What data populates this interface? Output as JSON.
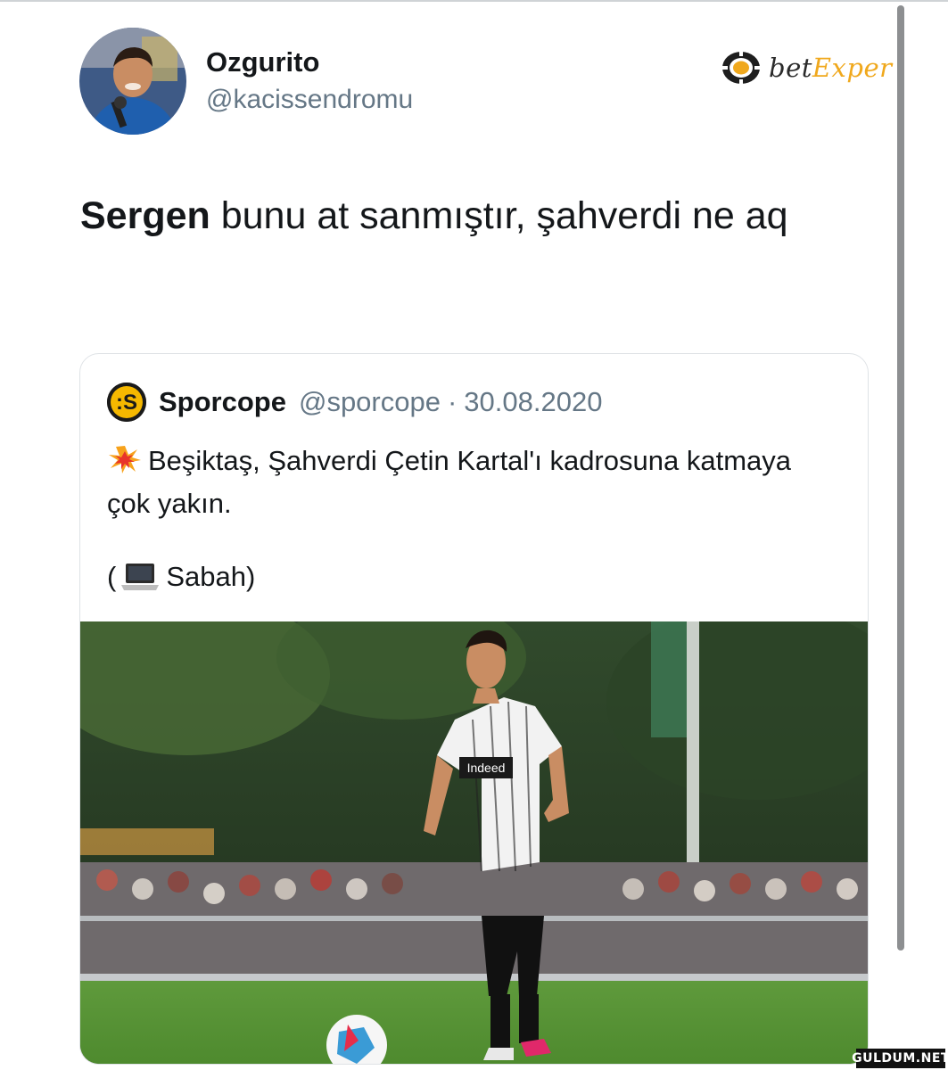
{
  "tweet": {
    "author_name": "Ozgurito",
    "author_handle": "@kacissendromu",
    "text_bold": "Sergen",
    "text_rest": " bunu at sanmıştır, şahverdi ne aq"
  },
  "brand_logo": {
    "part1": "bet",
    "part2": "Exper",
    "colors": {
      "bet": "#2a2a2a",
      "exper": "#f0a81c"
    }
  },
  "quoted_tweet": {
    "account_name": "Sporcope",
    "account_handle": "@sporcope",
    "separator": "·",
    "date": "30.08.2020",
    "body": "Beşiktaş, Şahverdi Çetin Kartal'ı kadrosuna katmaya çok yakın.",
    "body_icon": "collision-emoji-icon",
    "source_prefix": "(",
    "source_icon": "laptop-emoji-icon",
    "source_text": "Sabah)",
    "photo_jersey_sponsor": "Indeed"
  },
  "watermark": "GULDUM.NET",
  "colors": {
    "text": "#14171a",
    "muted": "#657786",
    "border": "#dfe3e6"
  }
}
